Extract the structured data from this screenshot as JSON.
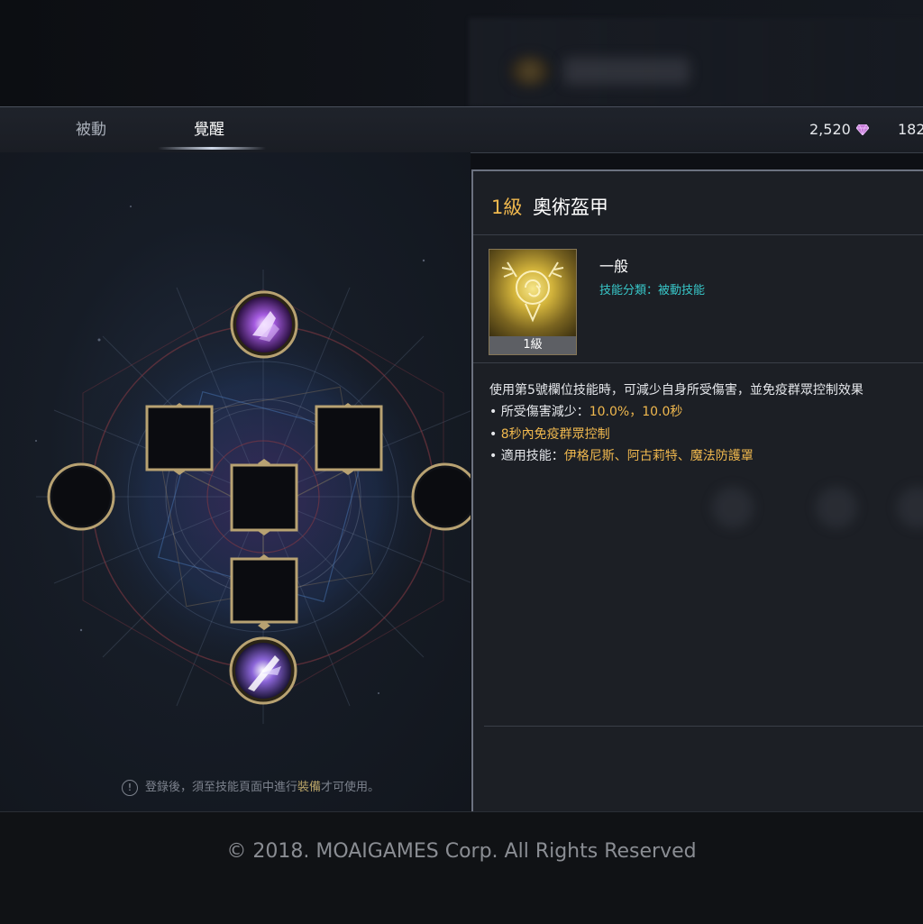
{
  "tabs": [
    {
      "label": "被動",
      "active": false
    },
    {
      "label": "覺醒",
      "active": true
    }
  ],
  "currency": {
    "gems": "2,520",
    "other": "182"
  },
  "notice": {
    "before": "登錄後，須至技能頁面中進行",
    "highlight": "裝備",
    "after": "才可使用。"
  },
  "skill": {
    "level": "1級",
    "name": "奧術盔甲",
    "icon_level": "1級",
    "grade": "一般",
    "category": "技能分類：被動技能",
    "description": "使用第5號欄位技能時，可減少自身所受傷害，並免疫群眾控制效果",
    "line1_label": "• 所受傷害減少：",
    "line1_value": "10.0%，10.0秒",
    "line2_bullet": "•",
    "line2_value1": "8秒內",
    "line2_value2": "免疫群眾控制",
    "line3_label": "• 適用技能：",
    "line3_value": "伊格尼斯、阿古莉特、魔法防護罩"
  },
  "footer": {
    "copyright": "© 2018. MOAIGAMES Corp. All Rights Reserved"
  },
  "colors": {
    "accent_gold": "#f0b84e",
    "category_cyan": "#38c7c9",
    "gem_purple": "#c77bd8"
  },
  "icons": [
    "gem-icon",
    "warning-icon",
    "skill-arcane-armor-icon",
    "awakening-skill-icon-top",
    "awakening-skill-icon-bottom"
  ]
}
